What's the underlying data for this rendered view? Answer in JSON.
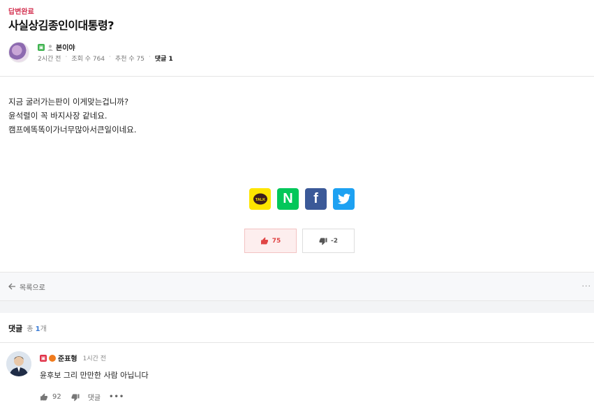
{
  "post": {
    "status": "답변완료",
    "title": "사실상김종인이대통령?",
    "author": "본이야",
    "time": "2시간 전",
    "views": "조회 수 764",
    "recommends": "추천 수 75",
    "comments_label": "댓글",
    "comments_count": "1",
    "body": [
      "지금 굴러가는판이 이게맞는겁니까?",
      "윤석렬이  꼭  바지사장  같네요.",
      "캠프에똑똑이가너무많아서큰일이네요."
    ]
  },
  "share": {
    "kakao": "TALK",
    "naver": "N",
    "facebook": "f"
  },
  "votes": {
    "up": "75",
    "down": "-2"
  },
  "list_bar": {
    "back_label": "목록으로",
    "more": "···"
  },
  "comments_section": {
    "title": "댓글",
    "total_prefix": "총 ",
    "total_count": "1",
    "total_suffix": "개"
  },
  "comment": {
    "author": "준표형",
    "time": "1시간 전",
    "text": "윤후보 그리 만만한 사람 아닙니다",
    "likes": "92",
    "reply_label": "댓글",
    "more": "•••"
  },
  "colors": {
    "accent_red": "#d3304f",
    "kakao": "#fee500",
    "naver": "#03c75a",
    "facebook": "#3b5998",
    "twitter": "#1da1f2"
  }
}
